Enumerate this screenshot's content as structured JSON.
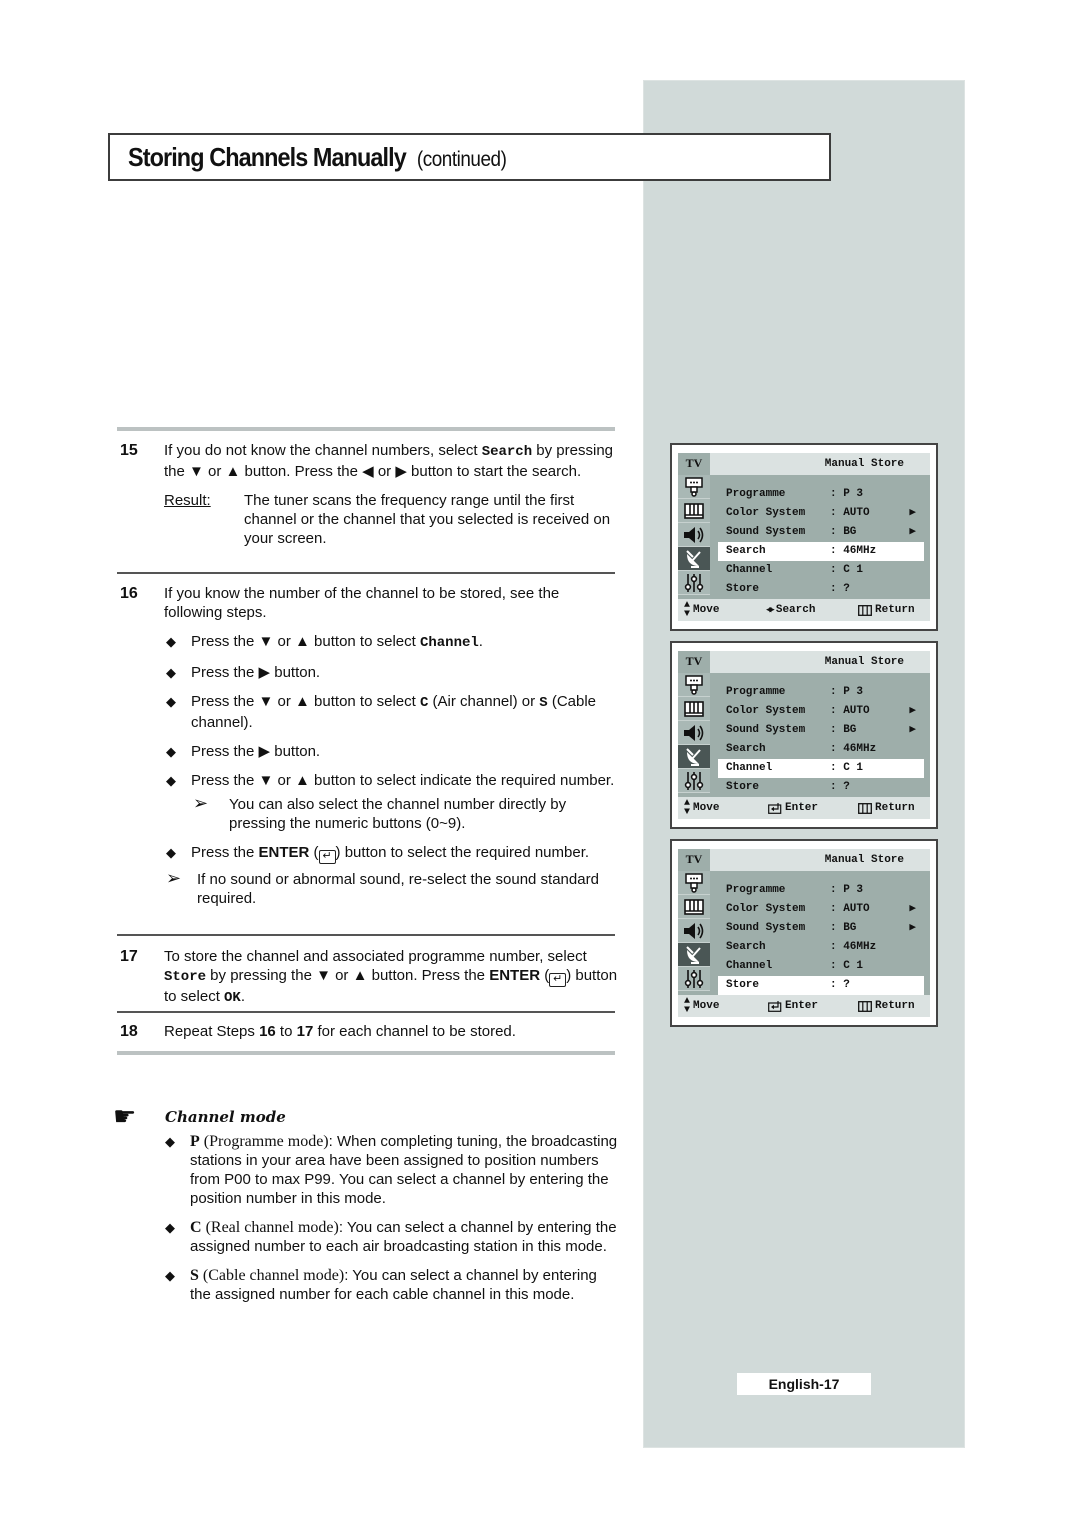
{
  "header": {
    "title": "Storing Channels Manually",
    "subtitle": "(continued)"
  },
  "steps": {
    "s15": {
      "num": "15",
      "text_a": "If you do not know the channel numbers, select ",
      "code": "Search",
      "text_b": " by pressing the ▼ or ▲ button. Press the ◀ or ▶ button to start the search.",
      "result_label": "Result:",
      "result_text": "The tuner scans the frequency range until the first channel or the channel that you selected is received on your screen."
    },
    "s16": {
      "num": "16",
      "intro": "If you know the number of the channel to be stored, see the following steps.",
      "b1_a": "Press the ▼ or ▲ button to select ",
      "b1_code": "Channel",
      "b1_b": ".",
      "b2": "Press the ▶ button.",
      "b3_a": "Press the ▼ or ▲ button to select ",
      "b3_c": "C",
      "b3_b": " (Air channel) or ",
      "b3_s": "S",
      "b3_d": " (Cable channel).",
      "b4": "Press the ▶ button.",
      "b5": "Press the ▼ or ▲ button to select indicate the required number.",
      "note1": "You can also select the channel number directly by pressing the numeric buttons (0~9).",
      "b6_a": "Press the ",
      "b6_enter": "ENTER",
      "b6_b": " button to select the required number.",
      "note2": "If no sound or abnormal sound, re-select the sound standard required."
    },
    "s17": {
      "num": "17",
      "text_a": "To store the channel and associated programme number, select ",
      "code": "Store",
      "text_b": " by pressing the ▼ or ▲  button. Press the ",
      "enter": "ENTER",
      "text_c": " button to select ",
      "ok": "OK",
      "text_d": "."
    },
    "s18": {
      "num": "18",
      "a": "Repeat Steps ",
      "n1": "16",
      "b": " to ",
      "n2": "17",
      "c": " for each channel to be stored."
    }
  },
  "channel_mode": {
    "title": "Channel mode",
    "items": [
      {
        "key": "P",
        "mode": " (Programme mode)",
        "text": ": When completing tuning, the broadcasting stations in your area have been assigned to position numbers from P00 to max P99. You can select a channel by entering the position number in this mode."
      },
      {
        "key": "C",
        "mode": " (Real channel mode)",
        "text": ": You can select a channel by entering the assigned number to each air broadcasting station in this mode."
      },
      {
        "key": "S",
        "mode": " (Cable channel mode)",
        "text": ": You can select a channel by entering the assigned number for each cable channel in this mode."
      }
    ]
  },
  "osd_screens": [
    {
      "tv": "TV",
      "title": "Manual Store",
      "highlight": "Search",
      "rows": [
        {
          "label": "Programme",
          "value": ": P 3"
        },
        {
          "label": "Color System",
          "value": ": AUTO"
        },
        {
          "label": "Sound System",
          "value": ": BG"
        },
        {
          "label": "Search",
          "value": ": 46MHz"
        },
        {
          "label": "Channel",
          "value": ": C 1"
        },
        {
          "label": "Store",
          "value": ": ?"
        }
      ],
      "footer": {
        "move": "Move",
        "action": "Search",
        "return": "Return"
      }
    },
    {
      "tv": "TV",
      "title": "Manual Store",
      "highlight": "Channel",
      "rows": [
        {
          "label": "Programme",
          "value": ": P 3"
        },
        {
          "label": "Color System",
          "value": ": AUTO"
        },
        {
          "label": "Sound System",
          "value": ": BG"
        },
        {
          "label": "Search",
          "value": ": 46MHz"
        },
        {
          "label": "Channel",
          "value": ": C 1"
        },
        {
          "label": "Store",
          "value": ": ?"
        }
      ],
      "footer": {
        "move": "Move",
        "action": "Enter",
        "return": "Return"
      }
    },
    {
      "tv": "TV",
      "title": "Manual Store",
      "highlight": "Store",
      "rows": [
        {
          "label": "Programme",
          "value": ": P 3"
        },
        {
          "label": "Color System",
          "value": ": AUTO"
        },
        {
          "label": "Sound System",
          "value": ": BG"
        },
        {
          "label": "Search",
          "value": ": 46MHz"
        },
        {
          "label": "Channel",
          "value": ": C 1"
        },
        {
          "label": "Store",
          "value": ": ?"
        }
      ],
      "footer": {
        "move": "Move",
        "action": "Enter",
        "return": "Return"
      }
    }
  ],
  "footer": {
    "page": "English-17"
  }
}
